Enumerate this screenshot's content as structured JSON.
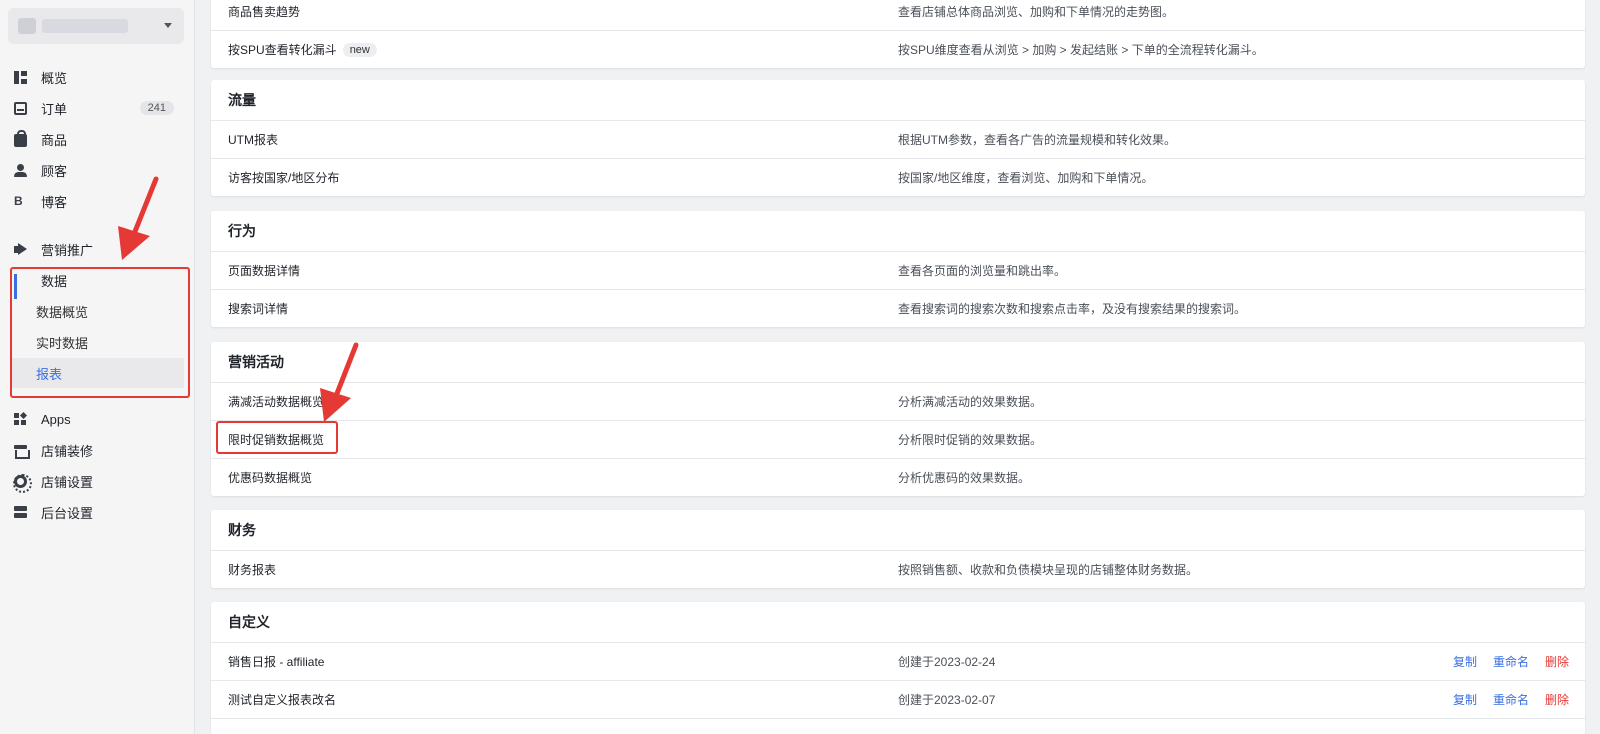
{
  "sidebar": {
    "orders_badge": "241",
    "items": [
      {
        "label": "概览"
      },
      {
        "label": "订单"
      },
      {
        "label": "商品"
      },
      {
        "label": "顾客"
      },
      {
        "label": "博客"
      },
      {
        "label": "营销推广"
      },
      {
        "label": "数据"
      },
      {
        "label": "Apps"
      },
      {
        "label": "店铺装修"
      },
      {
        "label": "店铺设置"
      },
      {
        "label": "后台设置"
      }
    ],
    "data_subitems": [
      {
        "label": "数据概览"
      },
      {
        "label": "实时数据"
      },
      {
        "label": "报表"
      }
    ],
    "blog_icon_text": "B"
  },
  "sections": {
    "top": {
      "rows": [
        {
          "name": "商品售卖趋势",
          "desc": "查看店铺总体商品浏览、加购和下单情况的走势图。"
        },
        {
          "name": "按SPU查看转化漏斗",
          "tag": "new",
          "desc": "按SPU维度查看从浏览 > 加购 > 发起结账 > 下单的全流程转化漏斗。"
        }
      ]
    },
    "traffic": {
      "title": "流量",
      "rows": [
        {
          "name": "UTM报表",
          "desc": "根据UTM参数，查看各广告的流量规模和转化效果。"
        },
        {
          "name": "访客按国家/地区分布",
          "desc": "按国家/地区维度，查看浏览、加购和下单情况。"
        }
      ]
    },
    "behavior": {
      "title": "行为",
      "rows": [
        {
          "name": "页面数据详情",
          "desc": "查看各页面的浏览量和跳出率。"
        },
        {
          "name": "搜索词详情",
          "desc": "查看搜索词的搜索次数和搜索点击率，及没有搜索结果的搜索词。"
        }
      ]
    },
    "marketing": {
      "title": "营销活动",
      "rows": [
        {
          "name": "满减活动数据概览",
          "desc": "分析满减活动的效果数据。"
        },
        {
          "name": "限时促销数据概览",
          "desc": "分析限时促销的效果数据。"
        },
        {
          "name": "优惠码数据概览",
          "desc": "分析优惠码的效果数据。"
        }
      ]
    },
    "finance": {
      "title": "财务",
      "rows": [
        {
          "name": "财务报表",
          "desc": "按照销售额、收款和负债模块呈现的店铺整体财务数据。"
        }
      ]
    },
    "custom": {
      "title": "自定义",
      "actions": {
        "copy": "复制",
        "rename": "重命名",
        "delete": "删除"
      },
      "rows": [
        {
          "name": "销售日报 - affiliate",
          "desc": "创建于2023-02-24"
        },
        {
          "name": "测试自定义报表改名",
          "desc": "创建于2023-02-07"
        }
      ]
    }
  },
  "colors": {
    "accent": "#3b6fe0",
    "danger": "#e53935",
    "highlight_box": "#e53935"
  }
}
